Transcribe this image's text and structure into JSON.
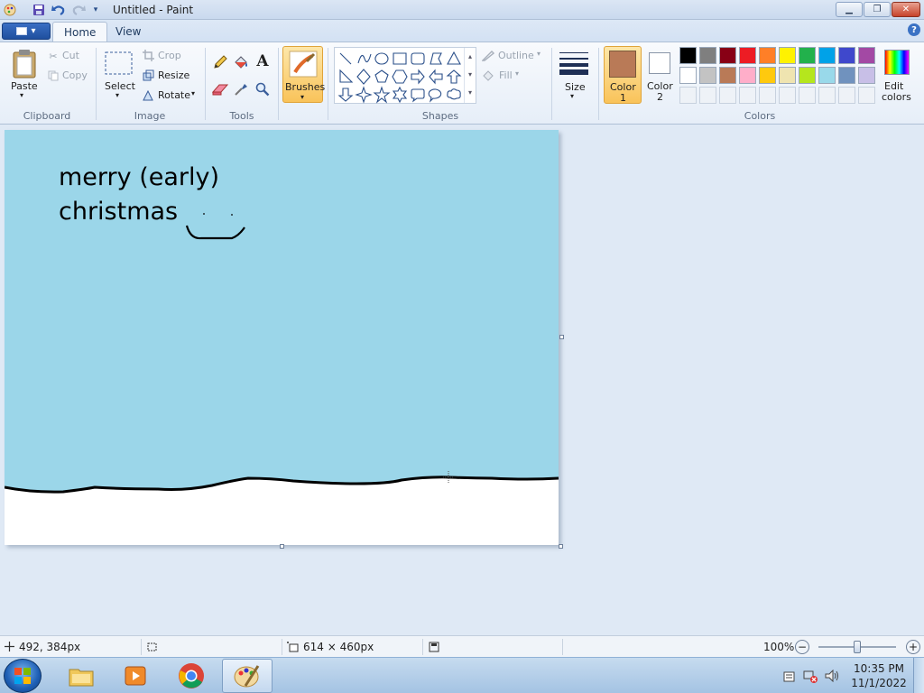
{
  "window": {
    "title": "Untitled - Paint",
    "controls": {
      "minimize": "minimize",
      "maximize": "restore",
      "close": "close"
    }
  },
  "quick_access": [
    "save-icon",
    "undo-icon",
    "redo-icon",
    "customize-dropdown-icon"
  ],
  "tabs": [
    {
      "label": "Home",
      "active": true
    },
    {
      "label": "View",
      "active": false
    }
  ],
  "ribbon": {
    "clipboard": {
      "group": "Clipboard",
      "paste": "Paste",
      "cut": "Cut",
      "copy": "Copy"
    },
    "image": {
      "group": "Image",
      "select": "Select",
      "crop": "Crop",
      "resize": "Resize",
      "rotate": "Rotate"
    },
    "tools": {
      "group": "Tools"
    },
    "brushes": {
      "label": "Brushes"
    },
    "shapes": {
      "group": "Shapes",
      "outline": "Outline",
      "fill": "Fill"
    },
    "size": {
      "label": "Size"
    },
    "colors": {
      "group": "Colors",
      "color1_label": "Color\n1",
      "color1_line1": "Color",
      "color1_line2": "1",
      "color1_value": "#b97a57",
      "color2_line1": "Color",
      "color2_line2": "2",
      "color2_value": "#ffffff",
      "edit_line1": "Edit",
      "edit_line2": "colors",
      "palette_row1": [
        "#000000",
        "#7f7f7f",
        "#880015",
        "#ed1c24",
        "#ff7f27",
        "#fff200",
        "#22b14c",
        "#00a2e8",
        "#3f48cc",
        "#a349a4"
      ],
      "palette_row2": [
        "#ffffff",
        "#c3c3c3",
        "#b97a57",
        "#ffaec9",
        "#ffc90e",
        "#efe4b0",
        "#b5e61d",
        "#99d9ea",
        "#7092be",
        "#c8bfe7"
      ]
    }
  },
  "canvas": {
    "text_line1": "merry (early)",
    "text_line2": "christmas",
    "sky_color": "#9bd6e9",
    "ground_color": "#ffffff"
  },
  "status": {
    "cursor_pos": "492, 384px",
    "canvas_size": "614 × 460px",
    "zoom": "100%"
  },
  "taskbar": {
    "items": [
      "explorer-icon",
      "media-player-icon",
      "chrome-icon",
      "paint-icon"
    ],
    "time": "10:35 PM",
    "date": "11/1/2022"
  }
}
